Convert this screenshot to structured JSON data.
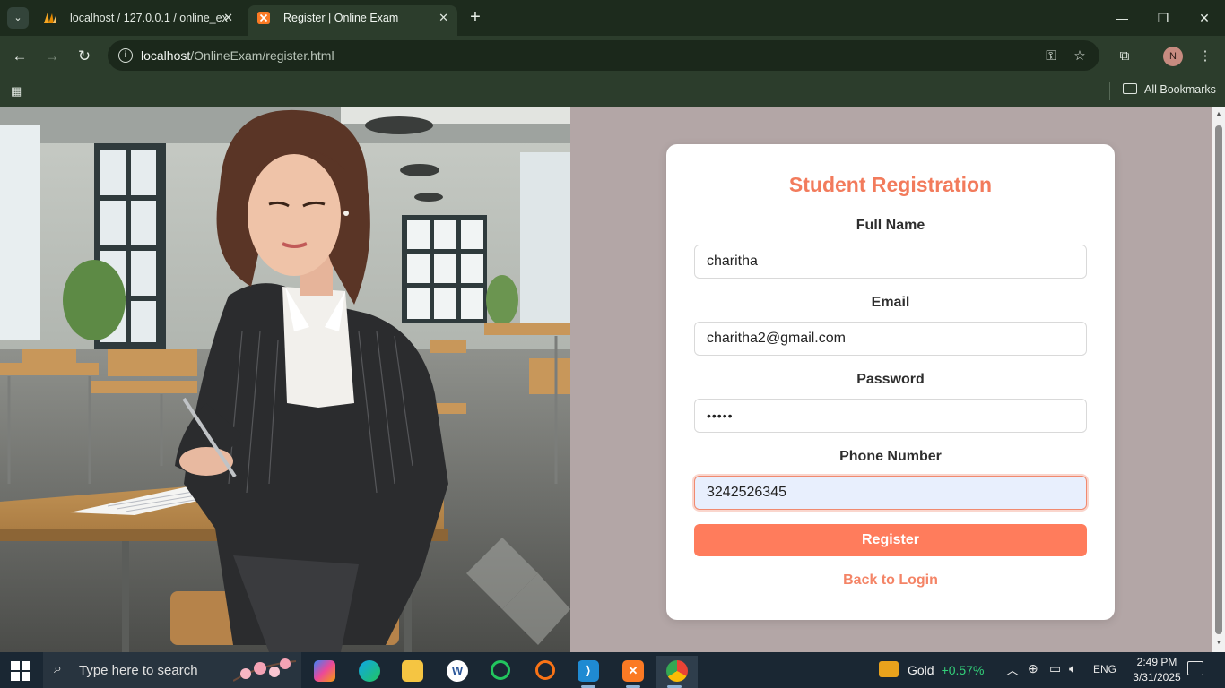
{
  "browser": {
    "tabs": [
      {
        "title": "localhost / 127.0.0.1 / online_ex",
        "active": false
      },
      {
        "title": "Register | Online Exam",
        "active": true
      }
    ],
    "new_tab": "+",
    "window_controls": {
      "minimize": "—",
      "restore": "❐",
      "close": "✕"
    },
    "url_host": "localhost",
    "url_path": "/OnlineExam/register.html",
    "all_bookmarks": "All Bookmarks",
    "profile_initial": "N"
  },
  "page": {
    "title": "Student Registration",
    "fields": {
      "full_name": {
        "label": "Full Name",
        "value": "charitha"
      },
      "email": {
        "label": "Email",
        "value": "charitha2@gmail.com"
      },
      "password": {
        "label": "Password",
        "value": "•••••"
      },
      "phone": {
        "label": "Phone Number",
        "value": "3242526345"
      }
    },
    "register_button": "Register",
    "back_link": "Back to Login",
    "colors": {
      "accent": "#ff7c5c",
      "title": "#f27b5c",
      "background": "#b3a6a6"
    }
  },
  "taskbar": {
    "search_placeholder": "Type here to search",
    "apps": [
      "copilot-icon",
      "edge-icon",
      "file-explorer-icon",
      "word-icon",
      "refresh-app-icon",
      "eclipse-icon",
      "vscode-icon",
      "xampp-icon",
      "chrome-icon"
    ],
    "widget_name": "Gold",
    "widget_change": "+0.57%",
    "language": "ENG",
    "time": "2:49 PM",
    "date": "3/31/2025"
  }
}
